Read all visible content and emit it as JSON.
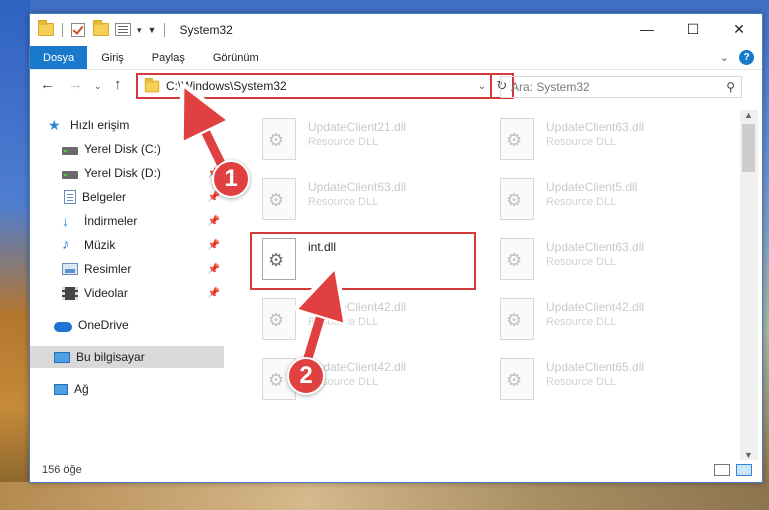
{
  "window": {
    "title": "System32",
    "controls": {
      "minimize": "—",
      "maximize": "☐",
      "close": "✕"
    }
  },
  "ribbon": {
    "tabs": [
      "Dosya",
      "Giriş",
      "Paylaş",
      "Görünüm"
    ],
    "help": "?"
  },
  "navbar": {
    "address": "C:\\Windows\\System32",
    "search_placeholder": "Ara: System32"
  },
  "sidebar": {
    "items": [
      {
        "label": "Hızlı erişim",
        "icon": "star-icon"
      },
      {
        "label": "Yerel Disk (C:)",
        "icon": "drive-icon",
        "pinned": true
      },
      {
        "label": "Yerel Disk (D:)",
        "icon": "drive-icon",
        "pinned": true
      },
      {
        "label": "Belgeler",
        "icon": "documents-icon",
        "pinned": true
      },
      {
        "label": "İndirmeler",
        "icon": "downloads-icon",
        "pinned": true
      },
      {
        "label": "Müzik",
        "icon": "music-icon",
        "pinned": true
      },
      {
        "label": "Resimler",
        "icon": "pictures-icon",
        "pinned": true
      },
      {
        "label": "Videolar",
        "icon": "videos-icon",
        "pinned": true
      },
      {
        "label": "OneDrive",
        "icon": "cloud-icon"
      },
      {
        "label": "Bu bilgisayar",
        "icon": "computer-icon",
        "selected": true
      },
      {
        "label": "Ağ",
        "icon": "network-icon"
      }
    ]
  },
  "files": [
    {
      "name": "UpdateClient21.dll",
      "type": "Resource DLL"
    },
    {
      "name": "UpdateClient63.dll",
      "type": "Resource DLL"
    },
    {
      "name": "UpdateClient63.dll",
      "type": "Resource DLL"
    },
    {
      "name": "UpdateClient5.dll",
      "type": "Resource DLL"
    },
    {
      "name": "int.dll",
      "type": ""
    },
    {
      "name": "UpdateClient63.dll",
      "type": "Resource DLL"
    },
    {
      "name": "UpdateClient42.dll",
      "type": "Resource DLL"
    },
    {
      "name": "UpdateClient42.dll",
      "type": "Resource DLL"
    },
    {
      "name": "UpdateClient42.dll",
      "type": "Resource DLL"
    },
    {
      "name": "UpdateClient65.dll",
      "type": "Resource DLL"
    }
  ],
  "status": {
    "item_count": "156 öğe"
  },
  "annotations": {
    "step1": "1",
    "step2": "2"
  },
  "colors": {
    "accent": "#1979ca",
    "highlight": "#d23a3a",
    "callout": "#e04040"
  }
}
